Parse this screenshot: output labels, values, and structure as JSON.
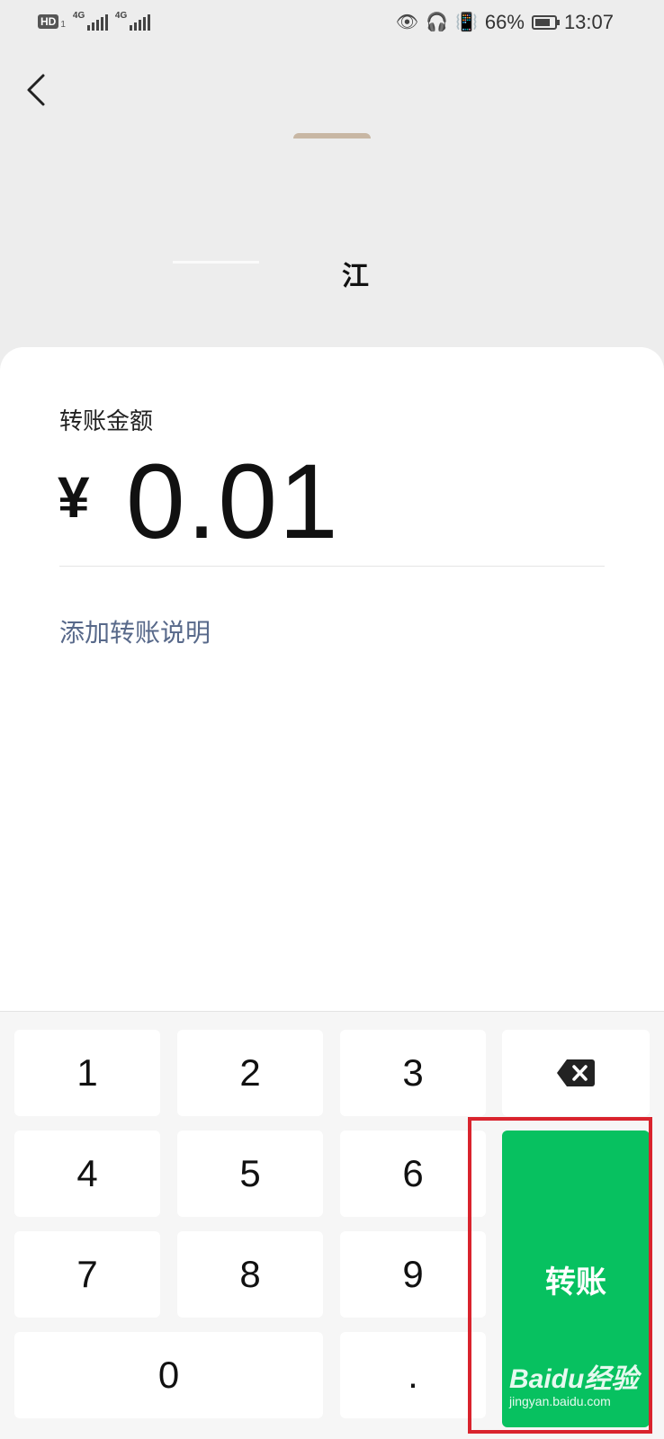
{
  "status_bar": {
    "hd": "HD",
    "sim1_network": "4G",
    "sim2_network": "4G",
    "battery_percent": "66%",
    "time": "13:07"
  },
  "header": {
    "recipient_name": "江"
  },
  "transfer": {
    "amount_label": "转账金额",
    "currency_symbol": "¥",
    "amount": "0.01",
    "add_note_link": "添加转账说明"
  },
  "keypad": {
    "keys": [
      "1",
      "2",
      "3",
      "4",
      "5",
      "6",
      "7",
      "8",
      "9",
      "0",
      "."
    ],
    "backspace_icon": "backspace-icon",
    "transfer_button": "转账"
  },
  "watermark": {
    "brand": "Baidu经验",
    "url": "jingyan.baidu.com"
  },
  "colors": {
    "accent_green": "#07c160",
    "highlight_red": "#d9232d",
    "link_blue_gray": "#58698a"
  }
}
